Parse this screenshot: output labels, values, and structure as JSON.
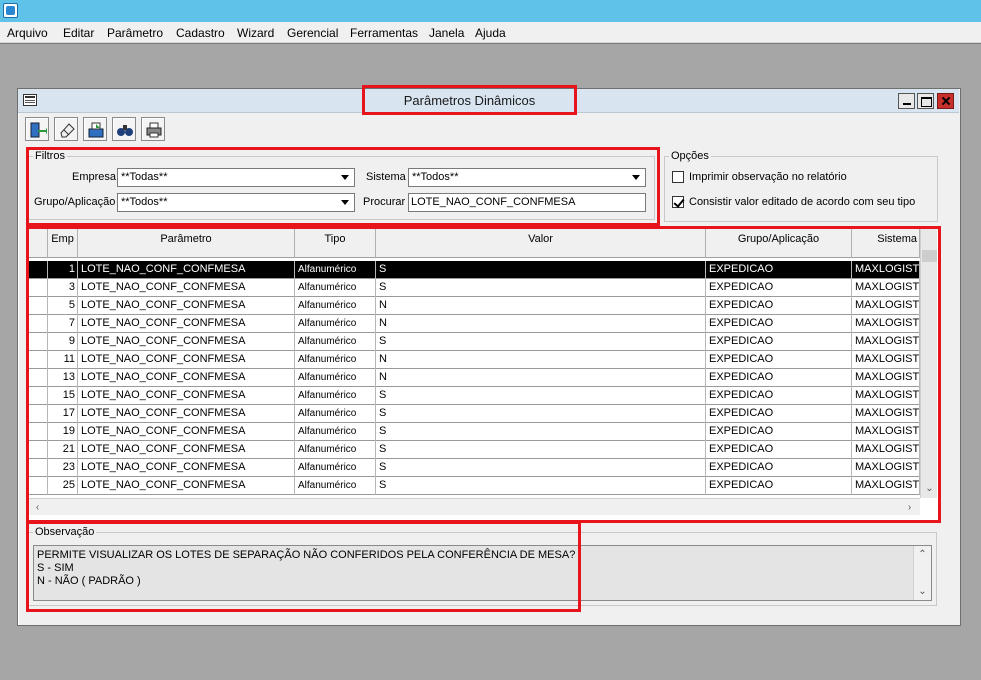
{
  "menu": [
    "Arquivo",
    "Editar",
    "Parâmetro",
    "Cadastro",
    "Wizard",
    "Gerencial",
    "Ferramentas",
    "Janela",
    "Ajuda"
  ],
  "window": {
    "title": "Parâmetros Dinâmicos"
  },
  "toolbar": {
    "buttons": [
      {
        "icon": "exit-door-icon"
      },
      {
        "icon": "eraser-icon"
      },
      {
        "icon": "save-disk-icon"
      },
      {
        "icon": "binoculars-icon"
      },
      {
        "icon": "printer-icon"
      }
    ]
  },
  "filters": {
    "group_label": "Filtros",
    "empresa_label": "Empresa",
    "empresa_value": "**Todas**",
    "grupo_label": "Grupo/Aplicação",
    "grupo_value": "**Todos**",
    "sistema_label": "Sistema",
    "sistema_value": "**Todos**",
    "procurar_label": "Procurar",
    "procurar_value": "LOTE_NAO_CONF_CONFMESA"
  },
  "options": {
    "group_label": "Opções",
    "imprimir_label": "Imprimir observação no relatório",
    "imprimir_checked": false,
    "consistir_label": "Consistir valor editado de acordo com seu tipo",
    "consistir_checked": true
  },
  "grid": {
    "headers": [
      "Emp",
      "Parâmetro",
      "Tipo",
      "Valor",
      "Grupo/Aplicação",
      "Sistema"
    ],
    "rows": [
      {
        "emp": "1",
        "param": "LOTE_NAO_CONF_CONFMESA",
        "tipo": "Alfanumérico",
        "valor": "S",
        "grupo": "EXPEDICAO",
        "sistema": "MAXLOGISTI",
        "selected": true
      },
      {
        "emp": "3",
        "param": "LOTE_NAO_CONF_CONFMESA",
        "tipo": "Alfanumérico",
        "valor": "S",
        "grupo": "EXPEDICAO",
        "sistema": "MAXLOGISTI"
      },
      {
        "emp": "5",
        "param": "LOTE_NAO_CONF_CONFMESA",
        "tipo": "Alfanumérico",
        "valor": "N",
        "grupo": "EXPEDICAO",
        "sistema": "MAXLOGISTI"
      },
      {
        "emp": "7",
        "param": "LOTE_NAO_CONF_CONFMESA",
        "tipo": "Alfanumérico",
        "valor": "N",
        "grupo": "EXPEDICAO",
        "sistema": "MAXLOGISTI"
      },
      {
        "emp": "9",
        "param": "LOTE_NAO_CONF_CONFMESA",
        "tipo": "Alfanumérico",
        "valor": "S",
        "grupo": "EXPEDICAO",
        "sistema": "MAXLOGISTI"
      },
      {
        "emp": "11",
        "param": "LOTE_NAO_CONF_CONFMESA",
        "tipo": "Alfanumérico",
        "valor": "N",
        "grupo": "EXPEDICAO",
        "sistema": "MAXLOGISTI"
      },
      {
        "emp": "13",
        "param": "LOTE_NAO_CONF_CONFMESA",
        "tipo": "Alfanumérico",
        "valor": "N",
        "grupo": "EXPEDICAO",
        "sistema": "MAXLOGISTI"
      },
      {
        "emp": "15",
        "param": "LOTE_NAO_CONF_CONFMESA",
        "tipo": "Alfanumérico",
        "valor": "S",
        "grupo": "EXPEDICAO",
        "sistema": "MAXLOGISTI"
      },
      {
        "emp": "17",
        "param": "LOTE_NAO_CONF_CONFMESA",
        "tipo": "Alfanumérico",
        "valor": "S",
        "grupo": "EXPEDICAO",
        "sistema": "MAXLOGISTI"
      },
      {
        "emp": "19",
        "param": "LOTE_NAO_CONF_CONFMESA",
        "tipo": "Alfanumérico",
        "valor": "S",
        "grupo": "EXPEDICAO",
        "sistema": "MAXLOGISTI"
      },
      {
        "emp": "21",
        "param": "LOTE_NAO_CONF_CONFMESA",
        "tipo": "Alfanumérico",
        "valor": "S",
        "grupo": "EXPEDICAO",
        "sistema": "MAXLOGISTI"
      },
      {
        "emp": "23",
        "param": "LOTE_NAO_CONF_CONFMESA",
        "tipo": "Alfanumérico",
        "valor": "S",
        "grupo": "EXPEDICAO",
        "sistema": "MAXLOGISTI"
      },
      {
        "emp": "25",
        "param": "LOTE_NAO_CONF_CONFMESA",
        "tipo": "Alfanumérico",
        "valor": "S",
        "grupo": "EXPEDICAO",
        "sistema": "MAXLOGISTI"
      }
    ]
  },
  "observacao": {
    "label": "Observação",
    "text": "PERMITE VISUALIZAR OS LOTES DE SEPARAÇÃO NÃO CONFERIDOS PELA CONFERÊNCIA DE MESA?\nS - SIM\nN - NÃO ( PADRÃO )"
  },
  "colors": {
    "highlight": "#e8141c",
    "titlebar": "#5fc2e9",
    "selected_row": "#000000"
  }
}
